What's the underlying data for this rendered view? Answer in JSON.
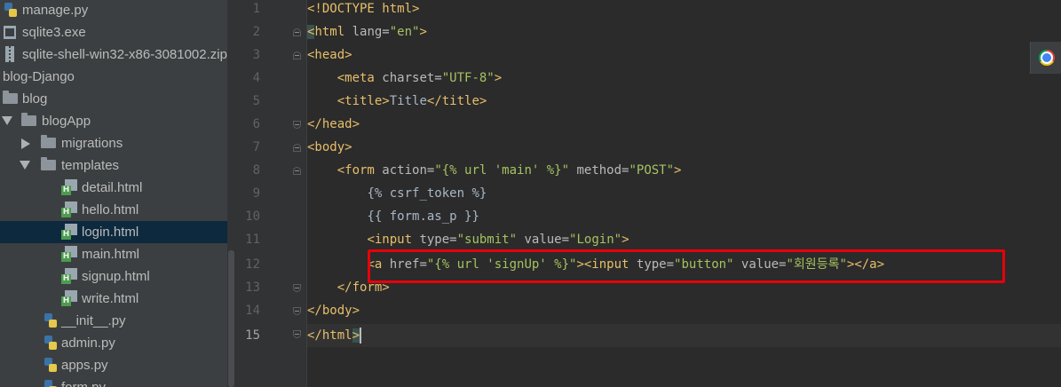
{
  "sidebar": {
    "items": [
      {
        "label": "manage.py",
        "icon": "python-file-icon"
      },
      {
        "label": "sqlite3.exe",
        "icon": "exe-file-icon"
      },
      {
        "label": "sqlite-shell-win32-x86-3081002.zip",
        "icon": "zip-file-icon"
      },
      {
        "label": "blog-Django",
        "icon": ""
      },
      {
        "label": "blog",
        "icon": "folder-icon"
      },
      {
        "label": "blogApp",
        "icon": "folder-icon"
      },
      {
        "label": "migrations",
        "icon": "folder-icon"
      },
      {
        "label": "templates",
        "icon": "folder-icon"
      },
      {
        "label": "detail.html",
        "icon": "html-file-icon"
      },
      {
        "label": "hello.html",
        "icon": "html-file-icon"
      },
      {
        "label": "login.html",
        "icon": "html-file-icon",
        "selected": true
      },
      {
        "label": "main.html",
        "icon": "html-file-icon"
      },
      {
        "label": "signup.html",
        "icon": "html-file-icon"
      },
      {
        "label": "write.html",
        "icon": "html-file-icon"
      },
      {
        "label": "__init__.py",
        "icon": "python-file-icon"
      },
      {
        "label": "admin.py",
        "icon": "python-file-icon"
      },
      {
        "label": "apps.py",
        "icon": "python-file-icon"
      },
      {
        "label": "form.py",
        "icon": "python-file-icon"
      }
    ]
  },
  "editor": {
    "line_numbers": [
      "1",
      "2",
      "3",
      "4",
      "5",
      "6",
      "7",
      "8",
      "9",
      "10",
      "11",
      "12",
      "13",
      "14",
      "15"
    ],
    "current_line": "15",
    "lines": {
      "l1": {
        "t1": "<!DOCTYPE html>"
      },
      "l2": {
        "t1": "<",
        "t2": "html",
        "t3": " lang=",
        "t4": "\"en\"",
        "t5": ">"
      },
      "l3": {
        "t1": "<head>"
      },
      "l4": {
        "indent": "    ",
        "t1": "<meta",
        "t2": " charset=",
        "t3": "\"UTF-8\"",
        "t4": ">"
      },
      "l5": {
        "indent": "    ",
        "t1": "<title>",
        "t2": "Title",
        "t3": "</title>"
      },
      "l6": {
        "t1": "</head>"
      },
      "l7": {
        "t1": "<body>"
      },
      "l8": {
        "indent": "    ",
        "t1": "<form",
        "t2": " action=",
        "t3": "\"{% url 'main' %}\"",
        "t4": " method=",
        "t5": "\"POST\"",
        "t6": ">"
      },
      "l9": {
        "indent": "        ",
        "t1": "{% csrf_token %}"
      },
      "l10": {
        "indent": "        ",
        "t1": "{{ form.as_p }}"
      },
      "l11": {
        "indent": "        ",
        "t1": "<input",
        "t2": " type=",
        "t3": "\"submit\"",
        "t4": " value=",
        "t5": "\"Login\"",
        "t6": ">"
      },
      "l12": {
        "indent": "        ",
        "t1": "<a",
        "t2": " href=",
        "t3": "\"{% url 'signUp' %}\"",
        "t4": "><input",
        "t5": " type=",
        "t6": "\"button\"",
        "t7": " value=",
        "t8": "\"회원등록\"",
        "t9": "></a>"
      },
      "l13": {
        "indent": "    ",
        "t1": "</form>"
      },
      "l14": {
        "t1": "</body>"
      },
      "l15": {
        "t1": "</",
        "t2": "html",
        "t3": ">"
      }
    }
  },
  "floating": {
    "browser_icon": "chrome-icon"
  },
  "colors": {
    "tag": "#e8bf6a",
    "attr_value": "#a5c261",
    "highlight_box": "#e8000a",
    "selection": "#0d293e"
  }
}
